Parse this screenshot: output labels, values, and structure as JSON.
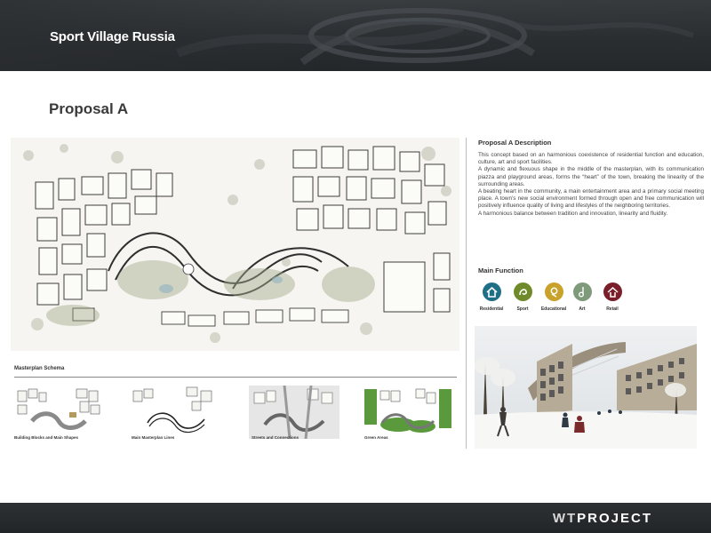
{
  "header": {
    "title": "Sport Village Russia"
  },
  "page": {
    "title": "Proposal A"
  },
  "schema": {
    "title": "Masterplan Schema",
    "items": [
      {
        "label": "Building Blocks and Main Shapes"
      },
      {
        "label": "Main Masterplan Lines"
      },
      {
        "label": "Streets and Connections"
      },
      {
        "label": "Green Areas"
      }
    ]
  },
  "description": {
    "title": "Proposal A Description",
    "paragraphs": [
      "This concept based on an harmonious coexistence of residential function and education, culture, art and sport facilities.",
      "A dynamic and flexuous shape in the middle of the masterplan, with its communication piazza and playground areas, forms the “heart” of the town, breaking the linearity of the surrounding areas.",
      "A beating heart in the community, a main entertainment area and a primary social meeting place. A town’s new social environment formed through open and free communication will positively influence quality of living and lifestyles of the neighboring territories.",
      "A harmonious balance between tradition and innovation, linearity and fluidity."
    ]
  },
  "functions": {
    "title": "Main Function",
    "items": [
      {
        "label": "Residential",
        "icon": "house-icon",
        "color": "#1f6f86"
      },
      {
        "label": "Sport",
        "icon": "sport-icon",
        "color": "#6f8a2a"
      },
      {
        "label": "Educational",
        "icon": "educational-icon",
        "color": "#c8a22a"
      },
      {
        "label": "Art",
        "icon": "art-icon",
        "color": "#7e9a7a"
      },
      {
        "label": "Retail",
        "icon": "retail-icon",
        "color": "#7a1e2a"
      }
    ]
  },
  "footer": {
    "brand_prefix": "WT",
    "brand_suffix": "PROJECT"
  }
}
